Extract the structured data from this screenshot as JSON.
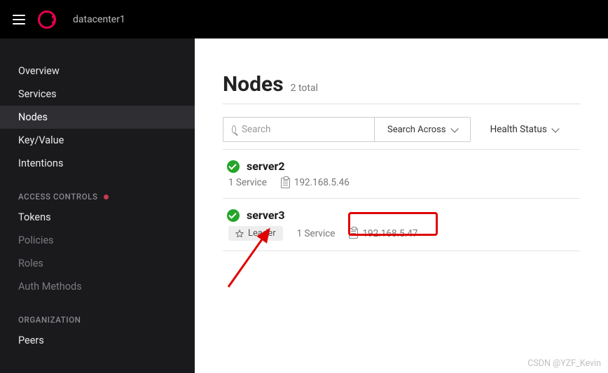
{
  "header": {
    "datacenter": "datacenter1"
  },
  "sidebar": {
    "nav": [
      {
        "label": "Overview",
        "active": false
      },
      {
        "label": "Services",
        "active": false
      },
      {
        "label": "Nodes",
        "active": true
      },
      {
        "label": "Key/Value",
        "active": false
      },
      {
        "label": "Intentions",
        "active": false
      }
    ],
    "section_access": "ACCESS CONTROLS",
    "access": [
      {
        "label": "Tokens",
        "dim": false
      },
      {
        "label": "Policies",
        "dim": true
      },
      {
        "label": "Roles",
        "dim": true
      },
      {
        "label": "Auth Methods",
        "dim": true
      }
    ],
    "section_org": "ORGANIZATION",
    "org": [
      {
        "label": "Peers",
        "dim": false
      }
    ]
  },
  "page": {
    "title": "Nodes",
    "subtitle": "2 total",
    "search_placeholder": "Search",
    "search_across": "Search Across",
    "health_status": "Health Status"
  },
  "nodes": [
    {
      "name": "server2",
      "services": "1 Service",
      "ip": "192.168.5.46",
      "leader": false
    },
    {
      "name": "server3",
      "services": "1 Service",
      "ip": "192.168.5.47",
      "leader": true,
      "leader_label": "Leader"
    }
  ],
  "watermark": "CSDN @YZF_Kevin"
}
